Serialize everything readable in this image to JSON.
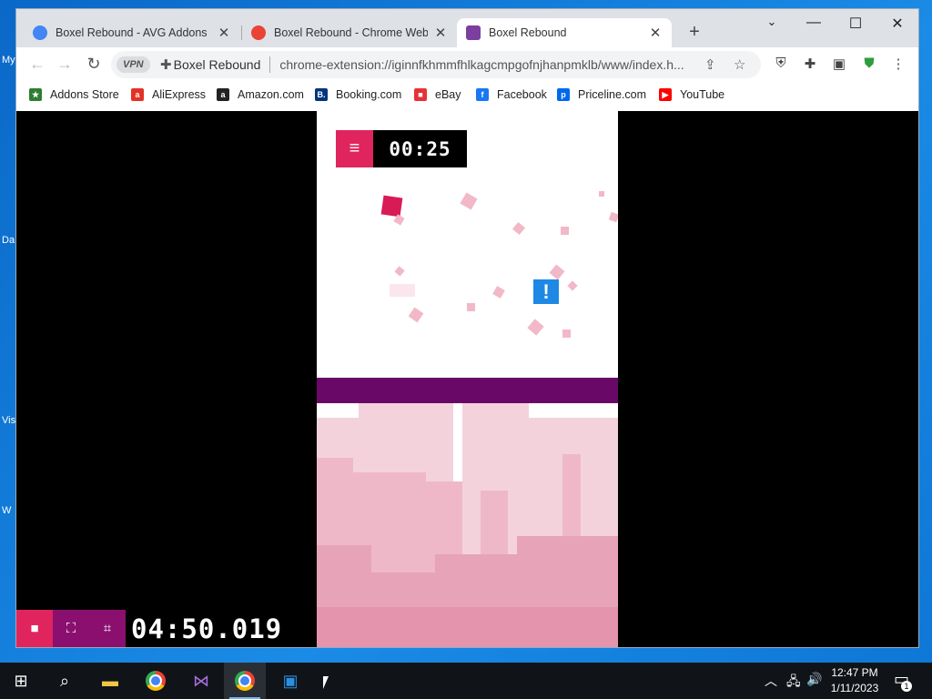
{
  "browser": {
    "tabs": [
      {
        "title": "Boxel Rebound - AVG Addons",
        "fav_color": "#4285f4"
      },
      {
        "title": "Boxel Rebound - Chrome Web S",
        "fav_color": "#ea4335"
      },
      {
        "title": "Boxel Rebound",
        "fav_color": "#7b3fa0"
      }
    ],
    "omnibox": {
      "vpn_label": "VPN",
      "site_name": "Boxel Rebound",
      "url": "chrome-extension://iginnfkhmmfhlkagcmpgofnjhanpmklb/www/index.h..."
    },
    "bookmarks": [
      {
        "label": "Addons Store",
        "icon": "addons-store-icon",
        "color": "#2e7d32",
        "glyph": "★"
      },
      {
        "label": "AliExpress",
        "icon": "aliexpress-icon",
        "color": "#e43225",
        "glyph": "a"
      },
      {
        "label": "Amazon.com",
        "icon": "amazon-icon",
        "color": "#222222",
        "glyph": "a"
      },
      {
        "label": "Booking.com",
        "icon": "booking-icon",
        "color": "#003580",
        "glyph": "B."
      },
      {
        "label": "eBay",
        "icon": "ebay-icon",
        "color": "#e53238",
        "glyph": "■"
      },
      {
        "label": "Facebook",
        "icon": "facebook-icon",
        "color": "#1877f2",
        "glyph": "f"
      },
      {
        "label": "Priceline.com",
        "icon": "priceline-icon",
        "color": "#0068ef",
        "glyph": "p"
      },
      {
        "label": "YouTube",
        "icon": "youtube-icon",
        "color": "#ff0000",
        "glyph": "▶"
      }
    ]
  },
  "game": {
    "timer": "00:25",
    "alert_symbol": "!",
    "colors": {
      "menu": "#e0245e",
      "player": "#d81b55",
      "bar": "#6a0868",
      "alert": "#1e88e5"
    }
  },
  "recorder": {
    "elapsed": "04:50.019"
  },
  "taskbar": {
    "time": "12:47 PM",
    "date": "1/11/2023",
    "notification_count": "1"
  }
}
